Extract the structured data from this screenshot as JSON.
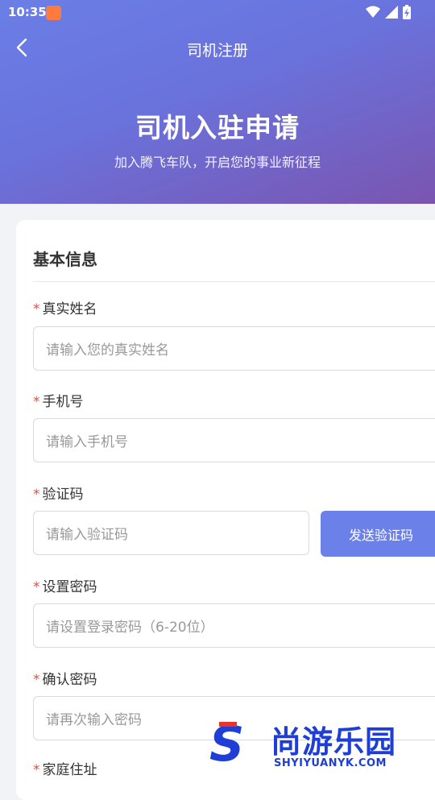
{
  "status_bar": {
    "time": "10:35",
    "icons": [
      "wifi-icon",
      "signal-icon",
      "battery-charging-icon"
    ]
  },
  "navbar": {
    "title": "司机注册",
    "back_icon": "chevron-left-icon"
  },
  "hero": {
    "title": "司机入驻申请",
    "subtitle": "加入腾飞车队，开启您的事业新征程"
  },
  "form": {
    "section_title": "基本信息",
    "required_mark": "*",
    "fields": [
      {
        "label": "真实姓名",
        "placeholder": "请输入您的真实姓名"
      },
      {
        "label": "手机号",
        "placeholder": "请输入手机号"
      },
      {
        "label": "验证码",
        "placeholder": "请输入验证码",
        "action": "发送验证码"
      },
      {
        "label": "设置密码",
        "placeholder": "请设置登录密码（6-20位）"
      },
      {
        "label": "确认密码",
        "placeholder": "请再次输入密码"
      },
      {
        "label": "家庭住址"
      }
    ]
  },
  "watermark": {
    "text": "尚游乐园",
    "url": "SHYIYUANYK.COM"
  },
  "colors": {
    "primary": "#6b80e8",
    "gradient_start": "#6a7fe6",
    "gradient_end": "#7a55b0",
    "required": "#e84c3d",
    "background": "#f2f3f7"
  }
}
